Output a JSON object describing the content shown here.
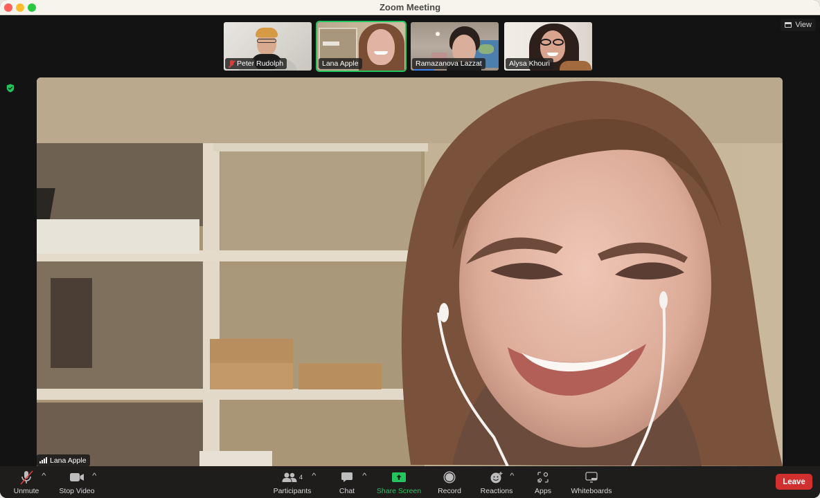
{
  "window": {
    "title": "Zoom Meeting"
  },
  "top_bar": {
    "view_label": "View"
  },
  "participants_strip": [
    {
      "name": "Peter Rudolph",
      "muted": true,
      "active_speaker": false
    },
    {
      "name": "Lana Apple",
      "muted": false,
      "active_speaker": true
    },
    {
      "name": "Ramazanova Lazzat",
      "muted": false,
      "active_speaker": false,
      "speaking_indicator": true
    },
    {
      "name": "Alysa Khouri",
      "muted": false,
      "active_speaker": false
    }
  ],
  "main_video": {
    "speaker_name": "Lana Apple",
    "signal_icon": "signal-strength-icon"
  },
  "security": {
    "icon": "shield-check-icon",
    "color": "#22c55e"
  },
  "toolbar": {
    "unmute": {
      "label": "Unmute",
      "icon": "mic-off-icon"
    },
    "stop_video": {
      "label": "Stop Video",
      "icon": "video-camera-icon"
    },
    "participants": {
      "label": "Participants",
      "count": "4",
      "icon": "participants-icon"
    },
    "chat": {
      "label": "Chat",
      "icon": "chat-bubble-icon"
    },
    "share_screen": {
      "label": "Share Screen",
      "icon": "share-screen-icon",
      "color": "#22c55e"
    },
    "record": {
      "label": "Record",
      "icon": "record-icon"
    },
    "reactions": {
      "label": "Reactions",
      "icon": "reactions-icon"
    },
    "apps": {
      "label": "Apps",
      "icon": "apps-icon"
    },
    "whiteboards": {
      "label": "Whiteboards",
      "icon": "whiteboard-icon"
    },
    "leave": {
      "label": "Leave",
      "color": "#d22f2f"
    }
  }
}
